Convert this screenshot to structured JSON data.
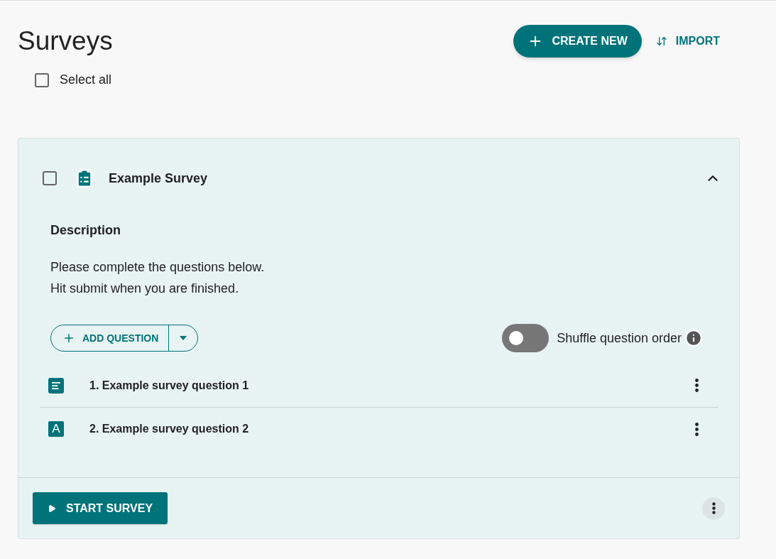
{
  "page": {
    "title": "Surveys"
  },
  "actions": [
    {
      "kind": "primary",
      "label": "CREATE NEW"
    },
    {
      "kind": "text",
      "label": "IMPORT"
    }
  ],
  "select_all": {
    "label": "Select all",
    "checked": false
  },
  "survey": {
    "title": "Example Survey",
    "checked": false,
    "expanded": true,
    "description_label": "Description",
    "description_lines": [
      "Please complete the questions below.",
      "Hit submit when you are finished."
    ],
    "add_question": "ADD QUESTION",
    "shuffle": {
      "label": "Shuffle question order",
      "on": false
    },
    "questions": [
      {
        "kind": "paragraph",
        "text": "1. Example survey question 1"
      },
      {
        "kind": "short_text",
        "icon_label": "A",
        "text": "2. Example survey question 2"
      }
    ],
    "start_button": "START SURVEY"
  }
}
